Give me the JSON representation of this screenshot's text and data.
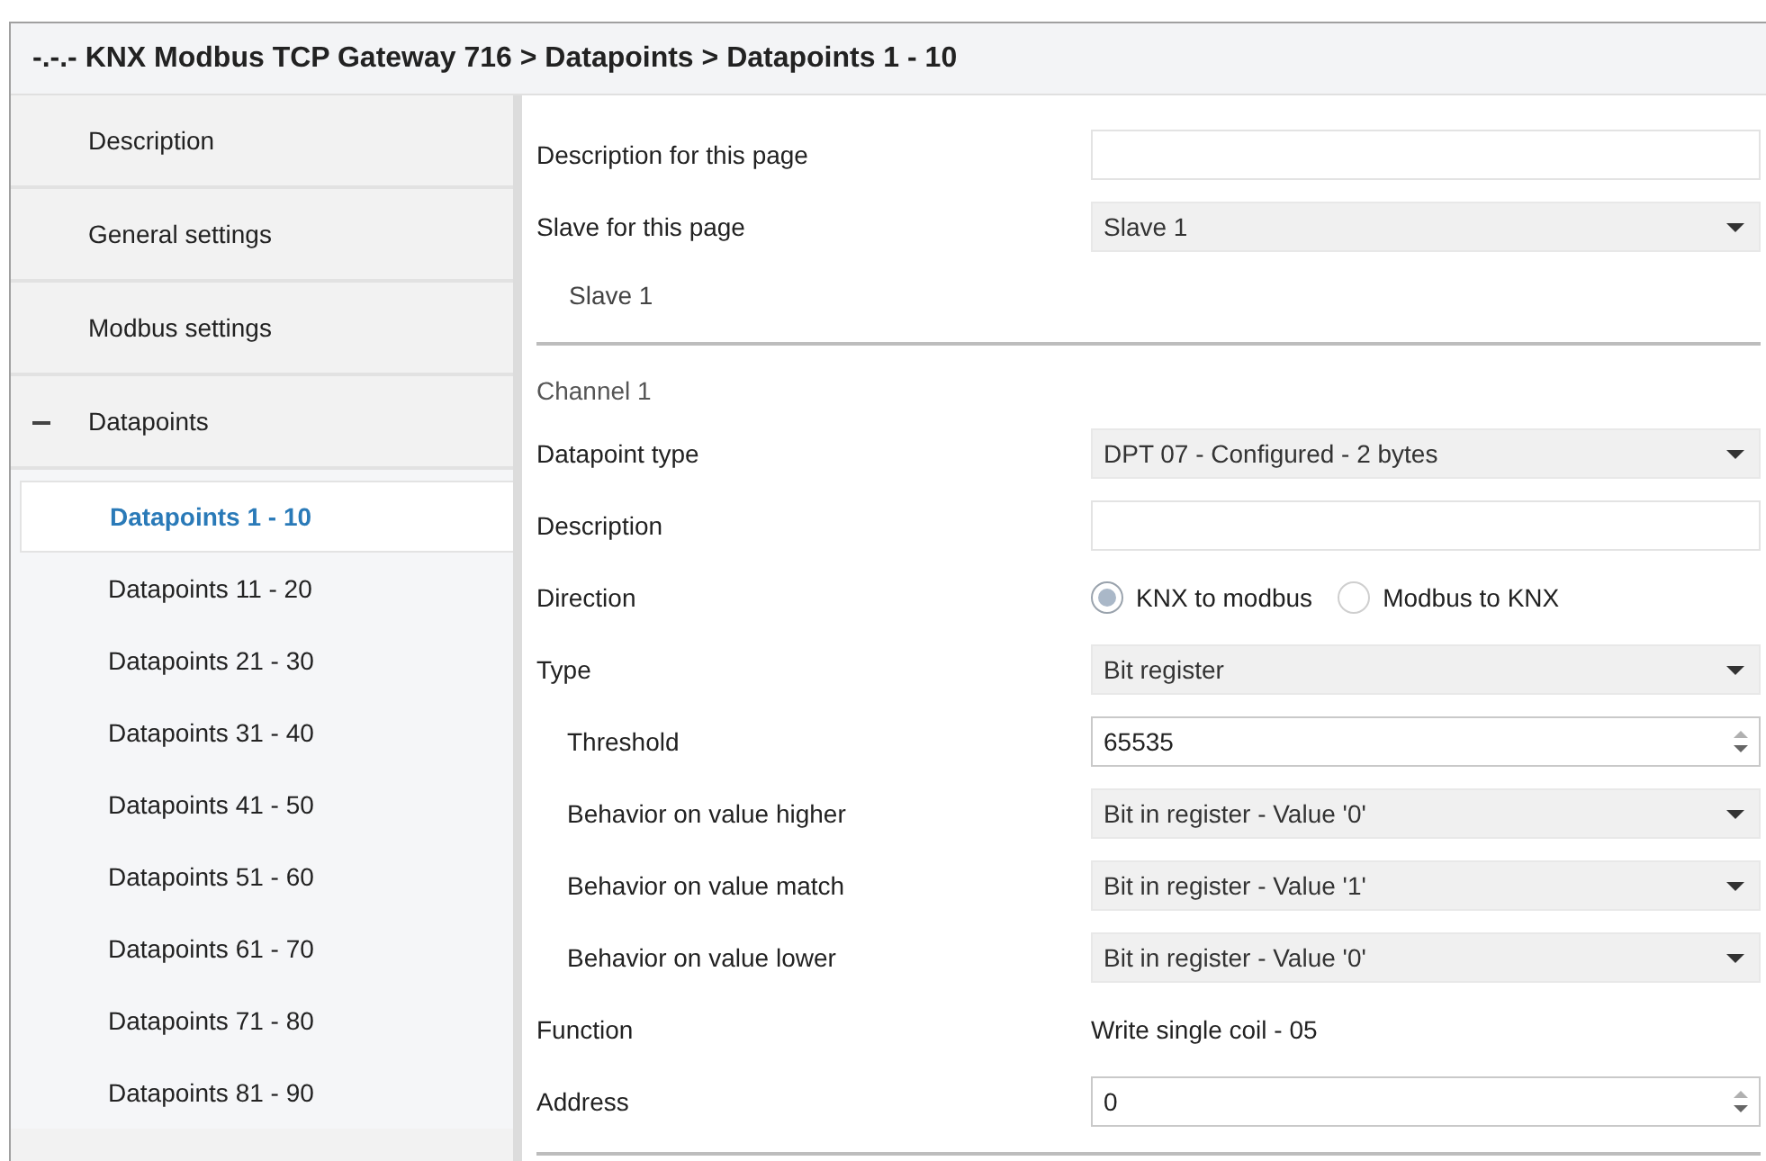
{
  "window": {
    "title": "-.-.- KNX Modbus TCP Gateway 716 > Datapoints > Datapoints 1 - 10"
  },
  "sidebar": {
    "items": [
      {
        "label": "Description",
        "selected": false
      },
      {
        "label": "General settings",
        "selected": false
      },
      {
        "label": "Modbus settings",
        "selected": false
      },
      {
        "label": "Datapoints",
        "selected": false,
        "expanded": true,
        "children": [
          {
            "label": "Datapoints 1 - 10",
            "selected": true
          },
          {
            "label": "Datapoints 11 - 20",
            "selected": false
          },
          {
            "label": "Datapoints 21 - 30",
            "selected": false
          },
          {
            "label": "Datapoints 31 - 40",
            "selected": false
          },
          {
            "label": "Datapoints 41 - 50",
            "selected": false
          },
          {
            "label": "Datapoints 51 - 60",
            "selected": false
          },
          {
            "label": "Datapoints 61 - 70",
            "selected": false
          },
          {
            "label": "Datapoints 71 - 80",
            "selected": false
          },
          {
            "label": "Datapoints 81 - 90",
            "selected": false
          }
        ]
      }
    ]
  },
  "form": {
    "rows": [
      {
        "kind": "text",
        "label": "Description for this page"
      },
      {
        "kind": "dropdown",
        "label": "Slave for this page",
        "value": "Slave 1"
      },
      {
        "kind": "note",
        "label": "Slave 1"
      },
      {
        "kind": "divider"
      },
      {
        "kind": "section",
        "label": "Channel 1"
      },
      {
        "kind": "dropdown",
        "label": "Datapoint type",
        "value": "DPT 07 - Configured - 2 bytes"
      },
      {
        "kind": "text",
        "label": "Description"
      },
      {
        "kind": "radio",
        "label": "Direction",
        "options": [
          {
            "label": "KNX to modbus",
            "selected": true
          },
          {
            "label": "Modbus to KNX",
            "selected": false
          }
        ]
      },
      {
        "kind": "dropdown",
        "label": "Type",
        "value": "Bit register",
        "children": [
          {
            "kind": "spin",
            "label": "Threshold",
            "value": "65535"
          },
          {
            "kind": "dropdown",
            "label": "Behavior on value higher",
            "value": "Bit in register - Value '0'"
          },
          {
            "kind": "dropdown",
            "label": "Behavior on value match",
            "value": "Bit in register - Value '1'"
          },
          {
            "kind": "dropdown",
            "label": "Behavior on value lower",
            "value": "Bit in register - Value '0'"
          }
        ]
      },
      {
        "kind": "static",
        "label": "Function",
        "value": "Write single coil - 05"
      },
      {
        "kind": "spin",
        "label": "Address",
        "value": "0"
      },
      {
        "kind": "divider"
      }
    ]
  }
}
